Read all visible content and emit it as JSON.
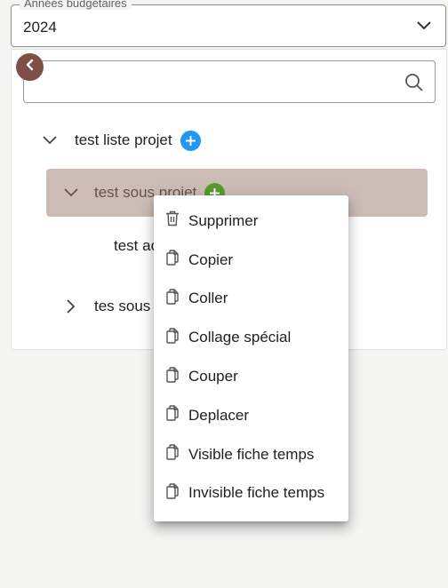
{
  "budget_year": {
    "legend": "Années budgétaires",
    "value": "2024",
    "icon": "chevron-down-icon"
  },
  "sidebar": {
    "collapse_icon": "chevron-left-icon",
    "collapse_color": "#7d4f46",
    "search": {
      "placeholder": "",
      "icon": "search-icon"
    }
  },
  "tree": {
    "items": [
      {
        "label": "test liste projet",
        "expanded": true,
        "add_color": "#2196f3"
      },
      {
        "label": "test sous projet",
        "expanded": true,
        "selected": true,
        "add_color": "#5a9a2e"
      },
      {
        "label": "test ac"
      },
      {
        "label": "tes sous",
        "expanded": false
      }
    ]
  },
  "context_menu": {
    "items": [
      {
        "label": "Supprimer",
        "icon": "trash-icon"
      },
      {
        "label": "Copier",
        "icon": "copy-icon"
      },
      {
        "label": "Coller",
        "icon": "copy-icon"
      },
      {
        "label": "Collage spécial",
        "icon": "copy-icon"
      },
      {
        "label": "Couper",
        "icon": "copy-icon"
      },
      {
        "label": "Deplacer",
        "icon": "copy-icon"
      },
      {
        "label": "Visible fiche temps",
        "icon": "copy-icon"
      },
      {
        "label": "Invisible fiche temps",
        "icon": "copy-icon"
      }
    ]
  },
  "colors": {
    "selected_row_bg": "#cbbdb6",
    "page_bg": "#f4f4f3"
  }
}
